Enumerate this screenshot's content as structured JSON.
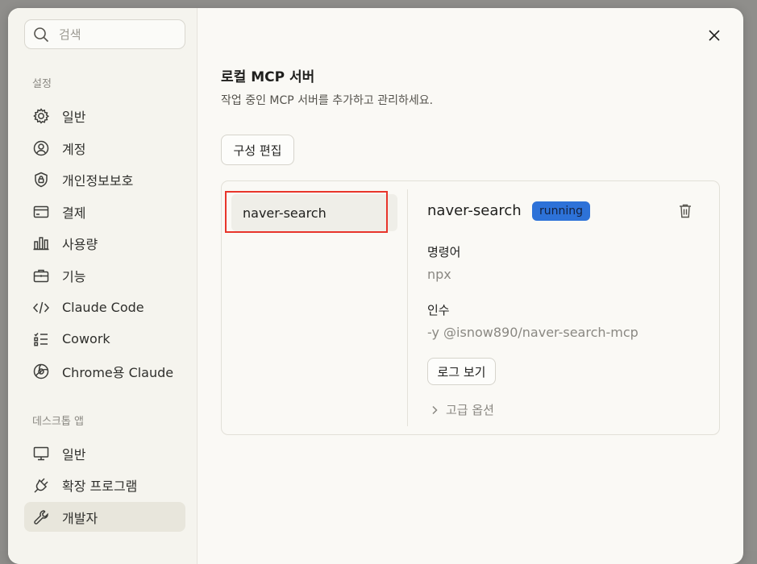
{
  "sidebar": {
    "search": {
      "placeholder": "검색"
    },
    "settings_section": "설정",
    "settings_items": [
      {
        "label": "일반",
        "icon": "gear-icon"
      },
      {
        "label": "계정",
        "icon": "user-circle-icon"
      },
      {
        "label": "개인정보보호",
        "icon": "shield-icon"
      },
      {
        "label": "결제",
        "icon": "credit-card-icon"
      },
      {
        "label": "사용량",
        "icon": "bar-chart-icon"
      },
      {
        "label": "기능",
        "icon": "briefcase-icon"
      },
      {
        "label": "Claude Code",
        "icon": "code-icon"
      },
      {
        "label": "Cowork",
        "icon": "checklist-icon"
      },
      {
        "label": "Chrome용 Claude",
        "icon": "globe-icon"
      }
    ],
    "desktop_section": "데스크톱 앱",
    "desktop_items": [
      {
        "label": "일반",
        "icon": "monitor-icon"
      },
      {
        "label": "확장 프로그램",
        "icon": "plug-icon"
      },
      {
        "label": "개발자",
        "icon": "wrench-icon",
        "active": true
      }
    ]
  },
  "main": {
    "title": "로컬 MCP 서버",
    "subtitle": "작업 중인 MCP 서버를 추가하고 관리하세요.",
    "edit_config_label": "구성 편집",
    "servers": [
      {
        "name": "naver-search"
      }
    ],
    "detail": {
      "name": "naver-search",
      "status": "running",
      "command_label": "명령어",
      "command_value": "npx",
      "args_label": "인수",
      "args_value": "-y @isnow890/naver-search-mcp",
      "log_button": "로그 보기",
      "advanced_label": "고급 옵션"
    }
  },
  "colors": {
    "highlight": "#e8352b",
    "status_badge": "#2d72d8",
    "active_nav": "#e8e6dc"
  }
}
